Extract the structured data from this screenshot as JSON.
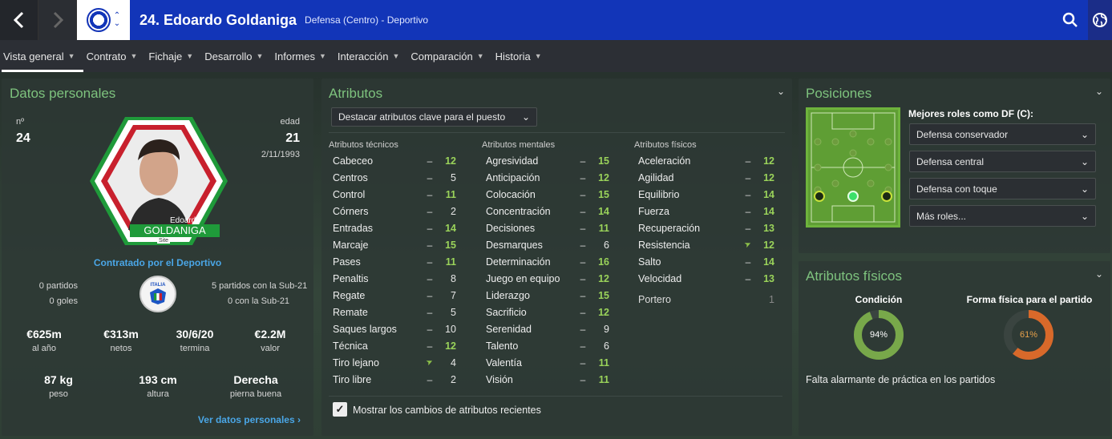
{
  "header": {
    "title": "24. Edoardo Goldaniga",
    "subtitle": "Defensa (Centro) - Deportivo"
  },
  "menu": [
    {
      "label": "Vista general"
    },
    {
      "label": "Contrato"
    },
    {
      "label": "Fichaje"
    },
    {
      "label": "Desarrollo"
    },
    {
      "label": "Informes"
    },
    {
      "label": "Interacción"
    },
    {
      "label": "Comparación"
    },
    {
      "label": "Historia"
    }
  ],
  "colors": {
    "accent": "#1235b8",
    "green": "#7ec37e",
    "highlight": "#9ad35a"
  },
  "personal": {
    "title": "Datos personales",
    "number_label": "nº",
    "number": "24",
    "age_label": "edad",
    "age": "21",
    "dob": "2/11/1993",
    "card_first": "Edoardo",
    "card_last": "GOLDANIGA",
    "card_tag": "Site",
    "contracted_by": "Contratado por el Deportivo",
    "caps": "0 partidos",
    "goals": "0 goles",
    "sub21_caps": "5 partidos con la Sub-21",
    "sub21_goals": "0 con la Sub-21",
    "badge_text": "ITALIA",
    "wage": "€625m",
    "wage_label": "al año",
    "net": "€313m",
    "net_label": "netos",
    "expiry": "30/6/20",
    "expiry_label": "termina",
    "value": "€2.2M",
    "value_label": "valor",
    "weight": "87 kg",
    "weight_label": "peso",
    "height": "193 cm",
    "height_label": "altura",
    "foot": "Derecha",
    "foot_label": "pierna buena",
    "link": "Ver datos personales"
  },
  "attributes": {
    "title": "Atributos",
    "highlight_dropdown": "Destacar atributos clave para el puesto",
    "technical_header": "Atributos técnicos",
    "mental_header": "Atributos mentales",
    "physical_header": "Atributos físicos",
    "technical": [
      {
        "name": "Cabeceo",
        "trend": "–",
        "value": "12",
        "key": true
      },
      {
        "name": "Centros",
        "trend": "–",
        "value": "5",
        "key": false
      },
      {
        "name": "Control",
        "trend": "–",
        "value": "11",
        "key": true
      },
      {
        "name": "Córners",
        "trend": "–",
        "value": "2",
        "key": false
      },
      {
        "name": "Entradas",
        "trend": "–",
        "value": "14",
        "key": true
      },
      {
        "name": "Marcaje",
        "trend": "–",
        "value": "15",
        "key": true
      },
      {
        "name": "Pases",
        "trend": "–",
        "value": "11",
        "key": true
      },
      {
        "name": "Penaltis",
        "trend": "–",
        "value": "8",
        "key": false
      },
      {
        "name": "Regate",
        "trend": "–",
        "value": "7",
        "key": false
      },
      {
        "name": "Remate",
        "trend": "–",
        "value": "5",
        "key": false
      },
      {
        "name": "Saques largos",
        "trend": "–",
        "value": "10",
        "key": false
      },
      {
        "name": "Técnica",
        "trend": "–",
        "value": "12",
        "key": true
      },
      {
        "name": "Tiro lejano",
        "trend": "➤",
        "value": "4",
        "key": false
      },
      {
        "name": "Tiro libre",
        "trend": "–",
        "value": "2",
        "key": false
      }
    ],
    "mental": [
      {
        "name": "Agresividad",
        "trend": "–",
        "value": "15",
        "key": true
      },
      {
        "name": "Anticipación",
        "trend": "–",
        "value": "12",
        "key": true
      },
      {
        "name": "Colocación",
        "trend": "–",
        "value": "15",
        "key": true
      },
      {
        "name": "Concentración",
        "trend": "–",
        "value": "14",
        "key": true
      },
      {
        "name": "Decisiones",
        "trend": "–",
        "value": "11",
        "key": true
      },
      {
        "name": "Desmarques",
        "trend": "–",
        "value": "6",
        "key": false
      },
      {
        "name": "Determinación",
        "trend": "–",
        "value": "16",
        "key": true
      },
      {
        "name": "Juego en equipo",
        "trend": "–",
        "value": "12",
        "key": true
      },
      {
        "name": "Liderazgo",
        "trend": "–",
        "value": "15",
        "key": true
      },
      {
        "name": "Sacrificio",
        "trend": "–",
        "value": "12",
        "key": true
      },
      {
        "name": "Serenidad",
        "trend": "–",
        "value": "9",
        "key": false
      },
      {
        "name": "Talento",
        "trend": "–",
        "value": "6",
        "key": false
      },
      {
        "name": "Valentía",
        "trend": "–",
        "value": "11",
        "key": true
      },
      {
        "name": "Visión",
        "trend": "–",
        "value": "11",
        "key": true
      }
    ],
    "physical": [
      {
        "name": "Aceleración",
        "trend": "–",
        "value": "12",
        "key": true
      },
      {
        "name": "Agilidad",
        "trend": "–",
        "value": "12",
        "key": true
      },
      {
        "name": "Equilibrio",
        "trend": "–",
        "value": "14",
        "key": true
      },
      {
        "name": "Fuerza",
        "trend": "–",
        "value": "14",
        "key": true
      },
      {
        "name": "Recuperación",
        "trend": "–",
        "value": "13",
        "key": true
      },
      {
        "name": "Resistencia",
        "trend": "➤",
        "value": "12",
        "key": true
      },
      {
        "name": "Salto",
        "trend": "–",
        "value": "14",
        "key": true
      },
      {
        "name": "Velocidad",
        "trend": "–",
        "value": "13",
        "key": true
      }
    ],
    "goalkeeper_label": "Portero",
    "goalkeeper_value": "1",
    "show_changes": "Mostrar los cambios de atributos recientes"
  },
  "positions": {
    "title": "Posiciones",
    "best_roles_label": "Mejores roles como DF (C):",
    "roles": [
      "Defensa conservador",
      "Defensa central",
      "Defensa con toque",
      "Más roles..."
    ]
  },
  "physical_panel": {
    "title": "Atributos físicos",
    "condition_label": "Condición",
    "condition_value": "94%",
    "condition_fraction": 0.94,
    "fitness_label": "Forma física para el partido",
    "fitness_value": "61%",
    "fitness_fraction": 0.61,
    "note": "Falta alarmante de práctica en los partidos"
  }
}
